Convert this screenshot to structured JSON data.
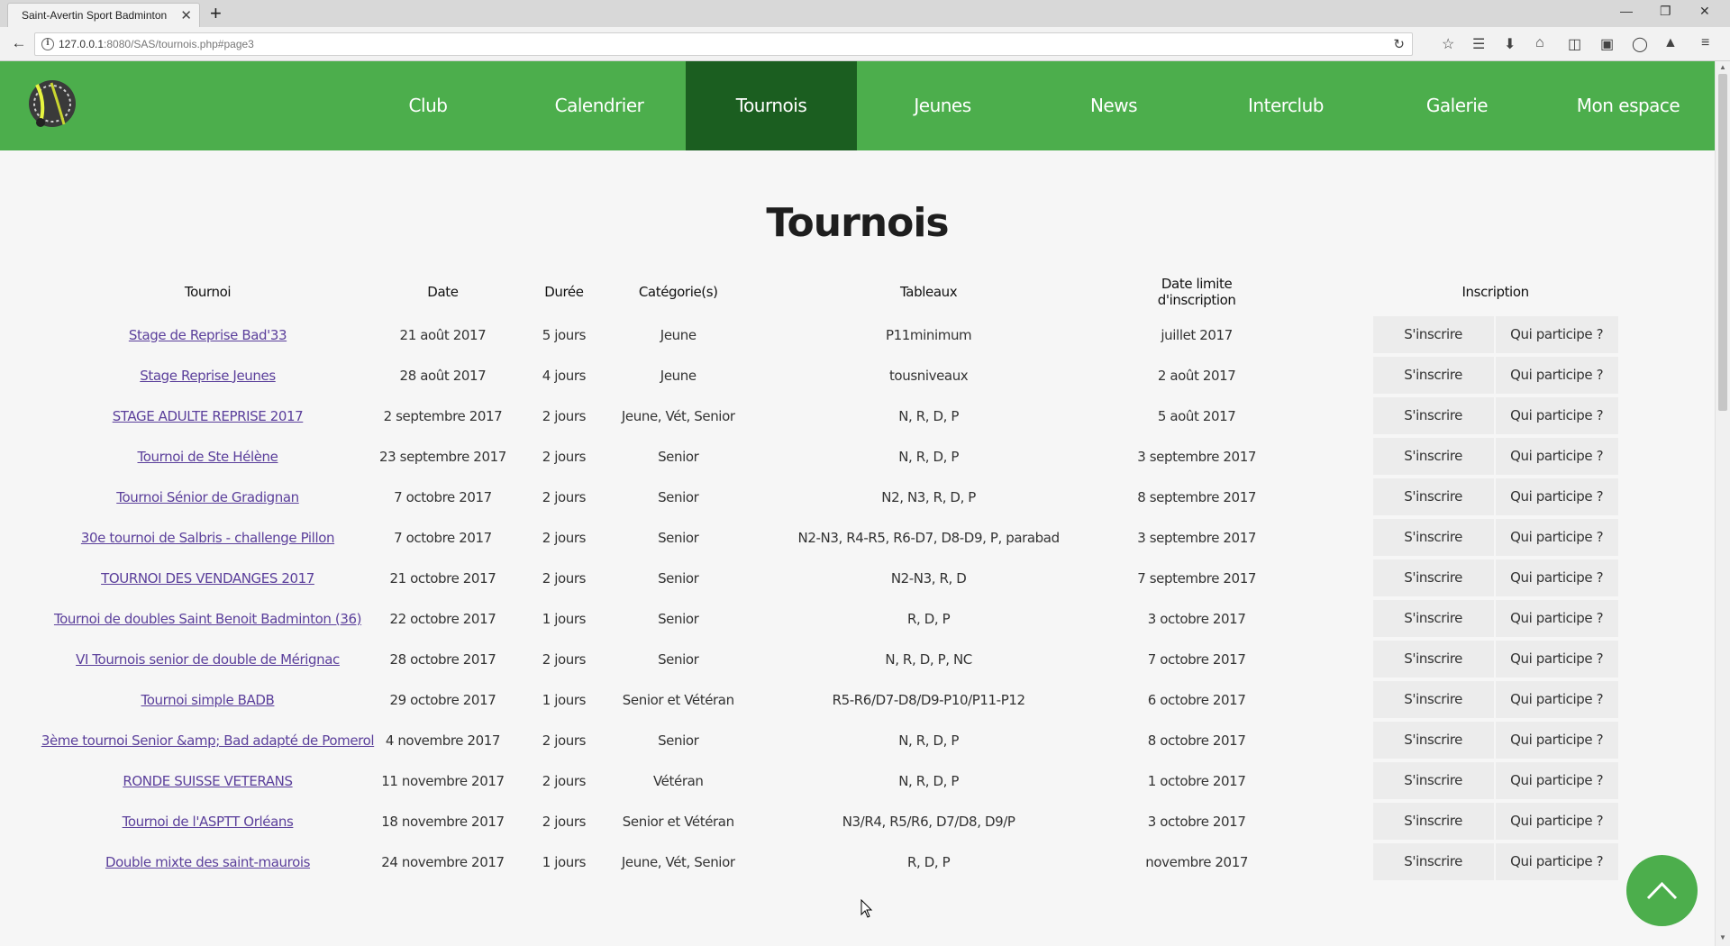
{
  "browser": {
    "tab_title": "Saint-Avertin Sport Badminton",
    "url_host": "127.0.0.1",
    "url_rest": ":8080/SAS/tournois.php#page3"
  },
  "site": {
    "colors": {
      "header": "#4cae4c",
      "active": "#1b5e20",
      "link": "#5b3f9b"
    },
    "menu": [
      "Club",
      "Calendrier",
      "Tournois",
      "Jeunes",
      "News",
      "Interclub",
      "Galerie",
      "Mon espace"
    ],
    "active_menu": "Tournois"
  },
  "page": {
    "title": "Tournois",
    "table": {
      "headers": {
        "tournoi": "Tournoi",
        "date": "Date",
        "duree": "Durée",
        "categories": "Catégorie(s)",
        "tableaux": "Tableaux",
        "limite_1": "Date limite",
        "limite_2": "d'inscription",
        "inscription": "Inscription"
      },
      "button_inscrire": "S'inscrire",
      "button_qui": "Qui participe ?",
      "rows": [
        {
          "name": "Stage de Reprise Bad'33",
          "date": "21 août 2017",
          "duree": "5 jours",
          "cat": "Jeune",
          "tableaux": "P11minimum",
          "limite": "juillet 2017"
        },
        {
          "name": "Stage Reprise Jeunes",
          "date": "28 août 2017",
          "duree": "4 jours",
          "cat": "Jeune",
          "tableaux": "tousniveaux",
          "limite": "2 août 2017"
        },
        {
          "name": "STAGE ADULTE REPRISE 2017",
          "date": "2 septembre 2017",
          "duree": "2 jours",
          "cat": "Jeune, Vét, Senior",
          "tableaux": "N, R, D, P",
          "limite": "5 août 2017"
        },
        {
          "name": "Tournoi de Ste Hélène",
          "date": "23 septembre 2017",
          "duree": "2 jours",
          "cat": "Senior",
          "tableaux": "N, R, D, P",
          "limite": "3 septembre 2017"
        },
        {
          "name": "Tournoi Sénior de Gradignan",
          "date": "7 octobre 2017",
          "duree": "2 jours",
          "cat": "Senior",
          "tableaux": "N2, N3, R, D, P",
          "limite": "8 septembre 2017"
        },
        {
          "name": "30e tournoi de Salbris - challenge Pillon",
          "date": "7 octobre 2017",
          "duree": "2 jours",
          "cat": "Senior",
          "tableaux": "N2-N3, R4-R5, R6-D7, D8-D9, P, parabad",
          "limite": "3 septembre 2017"
        },
        {
          "name": "TOURNOI DES VENDANGES 2017",
          "date": "21 octobre 2017",
          "duree": "2 jours",
          "cat": "Senior",
          "tableaux": "N2-N3, R, D",
          "limite": "7 septembre 2017"
        },
        {
          "name": "Tournoi de doubles Saint Benoit Badminton (36)",
          "date": "22 octobre 2017",
          "duree": "1 jours",
          "cat": "Senior",
          "tableaux": "R, D, P",
          "limite": "3 octobre 2017"
        },
        {
          "name": "VI Tournois senior de double de Mérignac",
          "date": "28 octobre 2017",
          "duree": "2 jours",
          "cat": "Senior",
          "tableaux": "N, R, D, P, NC",
          "limite": "7 octobre 2017"
        },
        {
          "name": "Tournoi simple BADB",
          "date": "29 octobre 2017",
          "duree": "1 jours",
          "cat": "Senior et Vétéran",
          "tableaux": "R5-R6/D7-D8/D9-P10/P11-P12",
          "limite": "6 octobre 2017"
        },
        {
          "name": "3ème tournoi Senior &amp; Bad adapté de Pomerol",
          "date": "4 novembre 2017",
          "duree": "2 jours",
          "cat": "Senior",
          "tableaux": "N, R, D, P",
          "limite": "8 octobre 2017"
        },
        {
          "name": "RONDE SUISSE VETERANS",
          "date": "11 novembre 2017",
          "duree": "2 jours",
          "cat": "Vétéran",
          "tableaux": "N, R, D, P",
          "limite": "1 octobre 2017"
        },
        {
          "name": "Tournoi de l'ASPTT Orléans",
          "date": "18 novembre 2017",
          "duree": "2 jours",
          "cat": "Senior et Vétéran",
          "tableaux": "N3/R4, R5/R6, D7/D8, D9/P",
          "limite": "3 octobre 2017"
        },
        {
          "name": "Double mixte des saint-maurois",
          "date": "24 novembre 2017",
          "duree": "1 jours",
          "cat": "Jeune, Vét, Senior",
          "tableaux": "R, D, P",
          "limite": "novembre 2017"
        }
      ]
    }
  }
}
